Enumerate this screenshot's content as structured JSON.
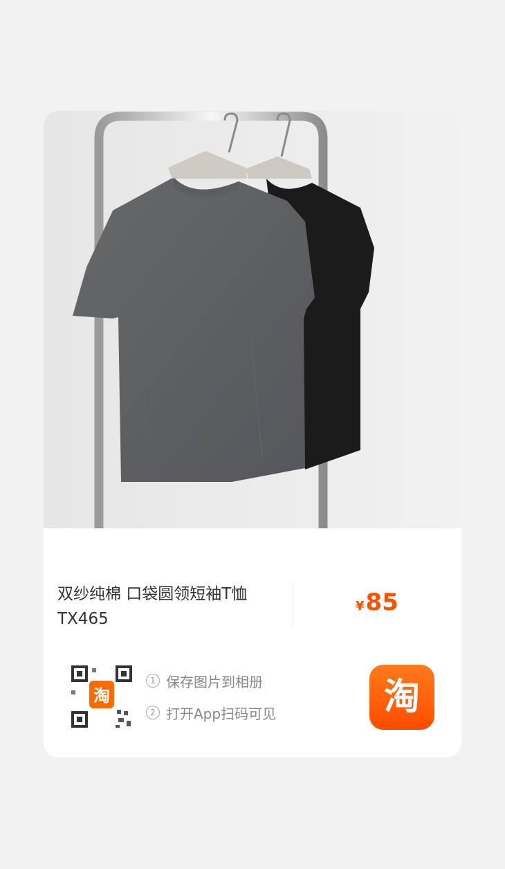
{
  "product": {
    "title": "双纱纯棉 口袋圆领短袖T恤TX465",
    "currency": "¥",
    "price": "85"
  },
  "share": {
    "steps": [
      {
        "num": "1",
        "text": "保存图片到相册"
      },
      {
        "num": "2",
        "text": "打开App扫码可见"
      }
    ],
    "app_icon_char": "淘",
    "qr_logo_char": "淘"
  },
  "colors": {
    "price": "#ff5000",
    "brand": "#ff6a00"
  }
}
